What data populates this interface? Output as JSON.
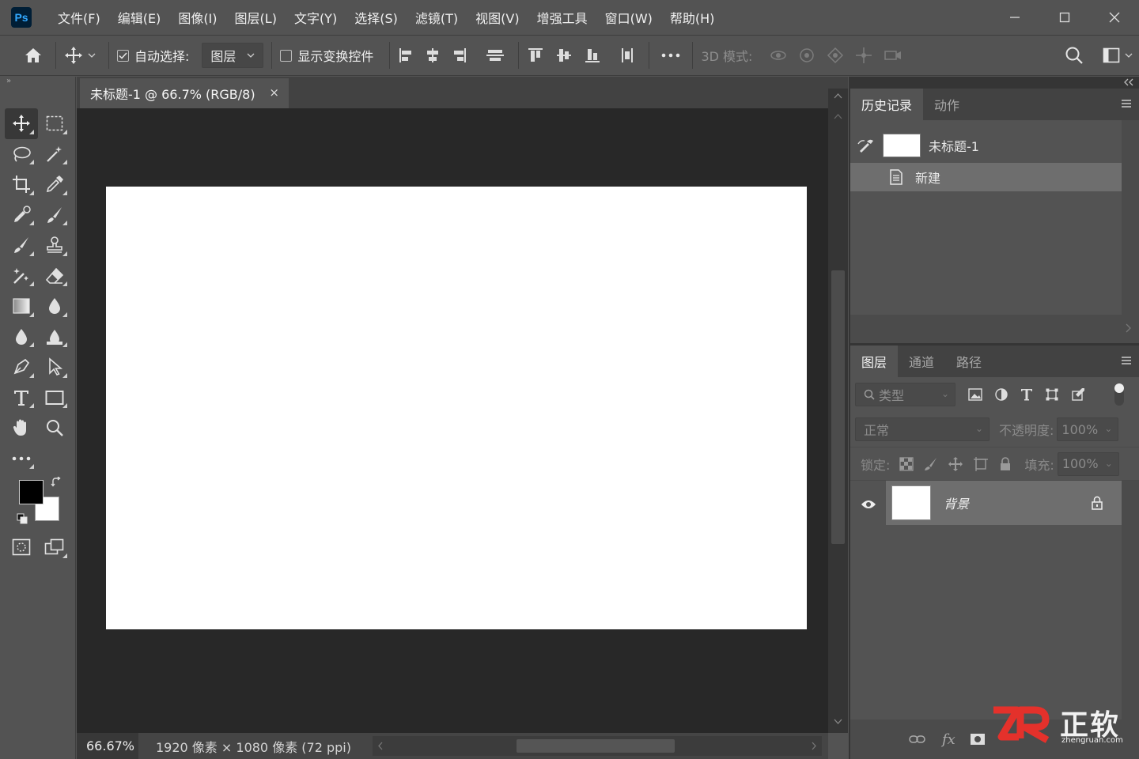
{
  "app": {
    "logo_text": "Ps"
  },
  "menu": [
    "文件(F)",
    "编辑(E)",
    "图像(I)",
    "图层(L)",
    "文字(Y)",
    "选择(S)",
    "滤镜(T)",
    "视图(V)",
    "增强工具",
    "窗口(W)",
    "帮助(H)"
  ],
  "options": {
    "auto_select_label": "自动选择:",
    "auto_select_checked": true,
    "auto_select_value": "图层",
    "show_transform_label": "显示变换控件",
    "show_transform_checked": false,
    "mode_3d_label": "3D 模式:"
  },
  "document": {
    "tab_title": "未标题-1 @ 66.7% (RGB/8)",
    "close_glyph": "×",
    "canvas_color": "#ffffff"
  },
  "status": {
    "zoom": "66.67%",
    "doc_info": "1920 像素 × 1080 像素 (72 ppi)"
  },
  "history_panel": {
    "tabs": [
      "历史记录",
      "动作"
    ],
    "snapshot_label": "未标题-1",
    "items": [
      "新建"
    ]
  },
  "layers_panel": {
    "tabs": [
      "图层",
      "通道",
      "路径"
    ],
    "filter_placeholder": "类型",
    "blend_mode": "正常",
    "opacity_label": "不透明度:",
    "opacity_value": "100%",
    "lock_label": "锁定:",
    "fill_label": "填充:",
    "fill_value": "100%",
    "layers": [
      {
        "name": "背景",
        "locked": true,
        "visible": true
      }
    ],
    "footer_fx": "fx"
  },
  "watermark": {
    "logo_text": "ZR",
    "cn_text": "正软",
    "url_text": "zhengruan.com"
  },
  "colors": {
    "accent": "#31a8ff",
    "watermark_red": "#e4312b"
  }
}
